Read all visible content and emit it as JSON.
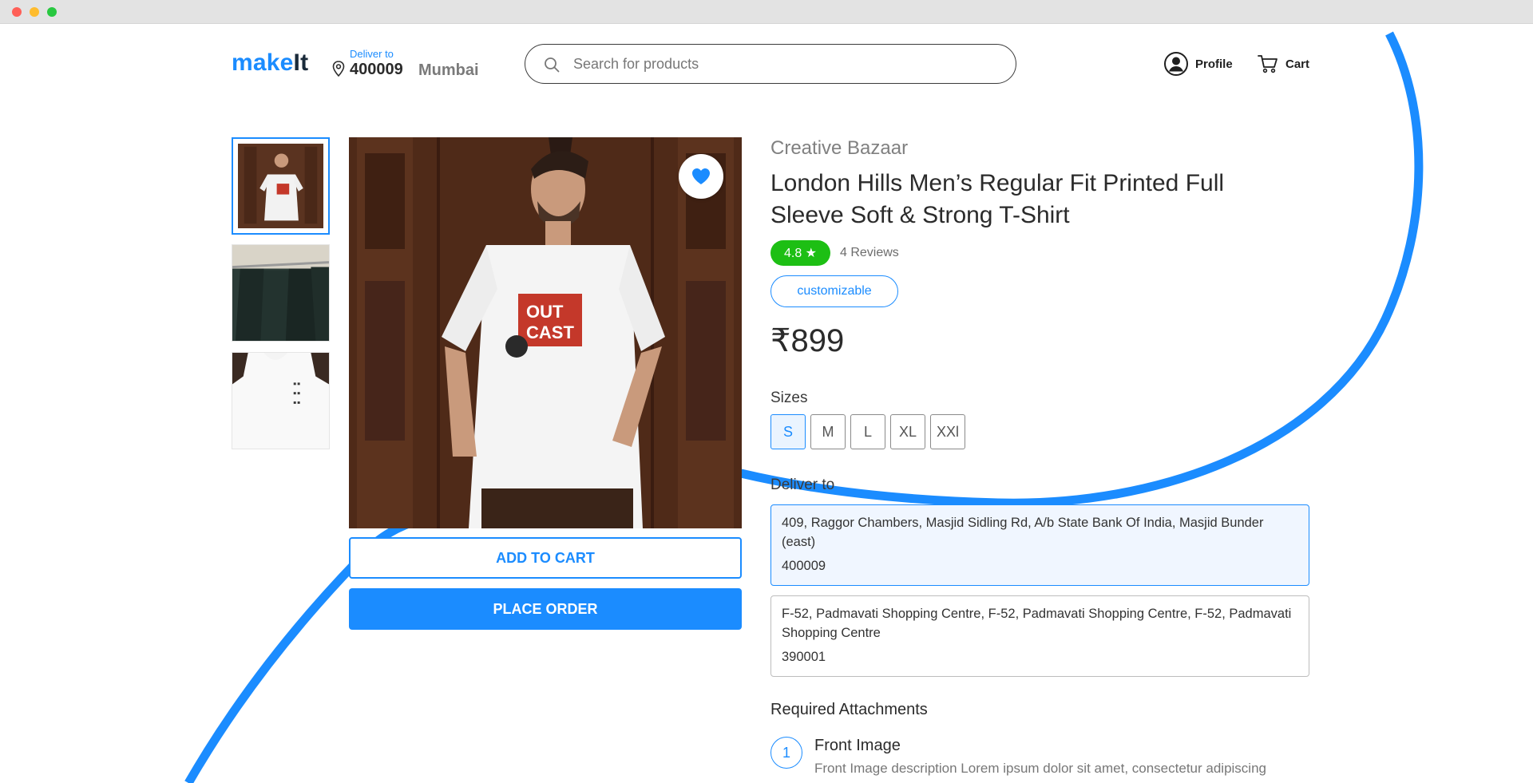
{
  "window": {
    "controls": [
      "close",
      "minimize",
      "maximize"
    ]
  },
  "colors": {
    "accent": "#1b8cff",
    "rating_badge": "#1dbf14",
    "text_dark": "#2b2b2b",
    "text_muted": "#808080"
  },
  "header": {
    "logo_part1": "make",
    "logo_part2": "It",
    "deliver_label": "Deliver to",
    "pincode": "400009",
    "city": "Mumbai",
    "search_placeholder": "Search for products",
    "search_value": "",
    "profile_label": "Profile",
    "cart_label": "Cart",
    "icons": [
      "location-pin-icon",
      "search-icon",
      "user-icon",
      "cart-icon"
    ]
  },
  "gallery": {
    "thumbnails": [
      {
        "alt": "Man in white printed t-shirt",
        "active": true
      },
      {
        "alt": "T-shirts on hangers",
        "active": false
      },
      {
        "alt": "Close-up of white t-shirt print",
        "active": false
      }
    ],
    "main_image_print_line1": "OUT",
    "main_image_print_line2": "CAST",
    "wishlist_icon": "heart-icon"
  },
  "actions": {
    "add_to_cart": "ADD TO CART",
    "place_order": "PLACE ORDER"
  },
  "product": {
    "brand": "Creative Bazaar",
    "title": "London Hills Men’s Regular Fit Printed Full Sleeve Soft & Strong T-Shirt",
    "rating": "4.8 ★",
    "reviews": "4 Reviews",
    "tag": "customizable",
    "price": "₹899",
    "sizes_heading": "Sizes",
    "sizes": [
      "S",
      "M",
      "L",
      "XL",
      "XXl"
    ],
    "selected_size": "S"
  },
  "delivery": {
    "heading": "Deliver to",
    "addresses": [
      {
        "line": "409, Raggor Chambers, Masjid Sidling Rd, A/b State Bank Of India, Masjid Bunder (east)",
        "zip": "400009",
        "selected": true
      },
      {
        "line": "F-52, Padmavati Shopping Centre, F-52, Padmavati Shopping Centre, F-52, Padmavati Shopping Centre",
        "zip": "390001",
        "selected": false
      }
    ]
  },
  "attachments": {
    "heading": "Required Attachments",
    "items": [
      {
        "number": "1",
        "title": "Front Image",
        "description": "Front Image description Lorem ipsum dolor sit amet, consectetur adipiscing"
      }
    ]
  }
}
